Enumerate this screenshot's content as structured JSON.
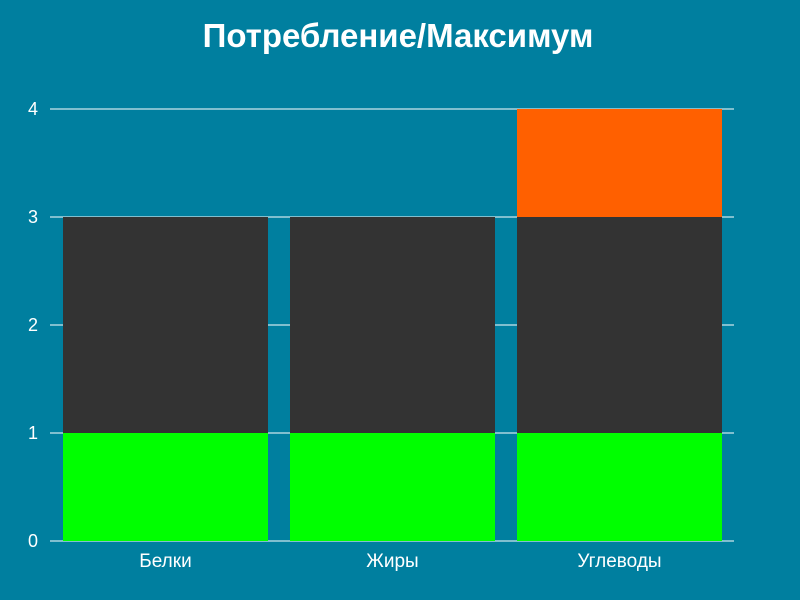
{
  "chart_data": {
    "type": "bar",
    "stacked": true,
    "title": "Потребление/Максимум",
    "xlabel": "",
    "ylabel": "",
    "ylim": [
      0,
      4
    ],
    "yticks": [
      "0",
      "1",
      "2",
      "3",
      "4"
    ],
    "categories": [
      "Белки",
      "Жиры",
      "Углеводы"
    ],
    "series": [
      {
        "color": "#00ff00",
        "values": [
          1,
          1,
          1
        ]
      },
      {
        "color": "#333333",
        "values": [
          2,
          2,
          2
        ]
      },
      {
        "color": "#ff6000",
        "values": [
          0,
          0,
          1
        ]
      }
    ],
    "grid": true,
    "background": "#007f9f",
    "gridColor": "#ffffff"
  }
}
